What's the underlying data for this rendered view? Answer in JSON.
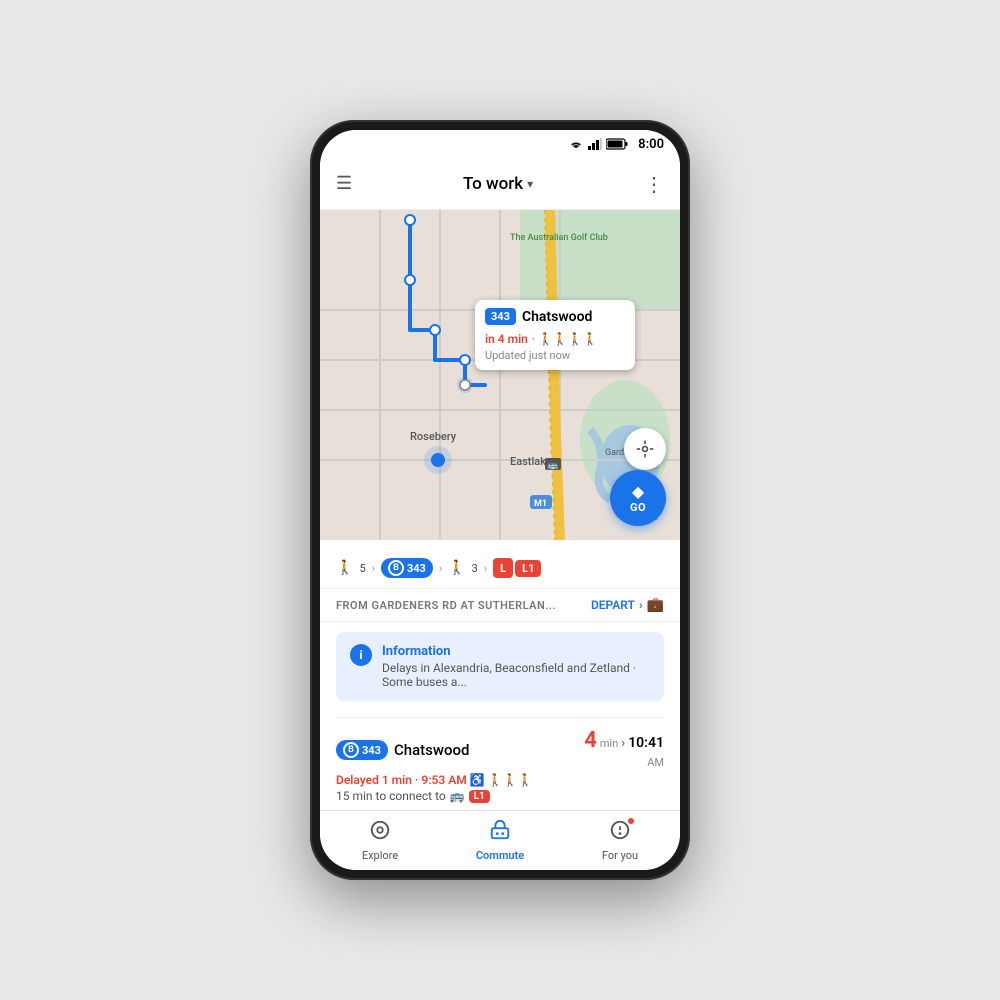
{
  "status_bar": {
    "time": "8:00"
  },
  "top_bar": {
    "menu_label": "☰",
    "title": "To work",
    "dropdown_arrow": "▾",
    "more_label": "⋮"
  },
  "map_tooltip": {
    "bus_number": "343",
    "destination": "Chatswood",
    "time_label": "in 4 min",
    "update_label": "Updated just now"
  },
  "go_button": {
    "label": "GO"
  },
  "route_summary": {
    "walk1_steps": "5",
    "bus_letter": "B",
    "bus_number": "343",
    "walk2_steps": "3",
    "train_letter": "L",
    "train_number": "L1"
  },
  "from_line": {
    "from_text": "FROM GARDENERS RD AT SUTHERLAN...",
    "depart_label": "DEPART"
  },
  "info_card": {
    "title": "Information",
    "body": "Delays in Alexandria, Beaconsfield and Zetland · Some buses a..."
  },
  "trip": {
    "bus_letter": "B",
    "bus_number": "343",
    "destination": "Chatswood",
    "delay_text": "Delayed 1 min · 9:53 AM",
    "connect_text": "15 min to connect to",
    "connect_route": "L1",
    "minutes": "4",
    "min_label": "min",
    "arrival_time": "10:41",
    "arrival_period": "AM"
  },
  "bottom_nav": {
    "explore_label": "Explore",
    "commute_label": "Commute",
    "for_you_label": "For you"
  }
}
